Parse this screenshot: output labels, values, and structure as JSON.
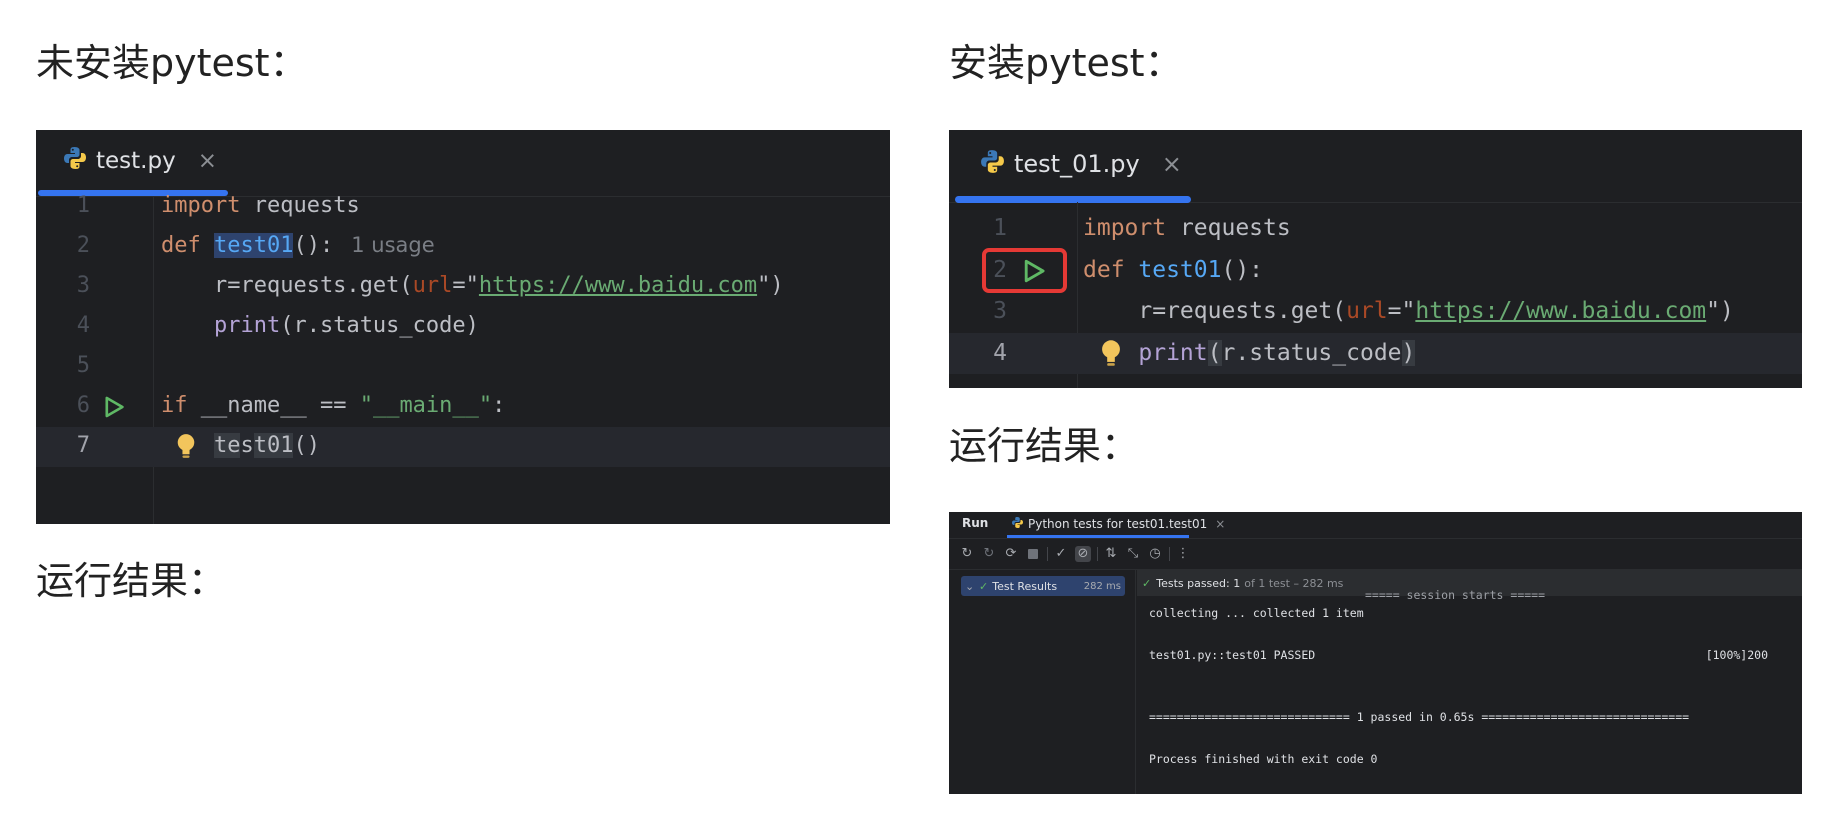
{
  "headings": {
    "left_top": "未安装pytest：",
    "left_result": "运行结果：",
    "right_top": "安装pytest：",
    "right_result": "运行结果："
  },
  "editor_left": {
    "tab_label": "test.py",
    "tab_close": "×",
    "current_line": 7,
    "lines": [
      {
        "num": "1",
        "parts": [
          [
            "kw",
            "import"
          ],
          [
            "txt",
            " requests"
          ]
        ]
      },
      {
        "num": "2",
        "parts": [
          [
            "kw",
            "def "
          ],
          [
            "fnhl",
            "test01"
          ],
          [
            "txt",
            "():"
          ]
        ],
        "hint": "1 usage"
      },
      {
        "num": "3",
        "parts": [
          [
            "txt",
            "    r=requests.get("
          ],
          [
            "param",
            "url"
          ],
          [
            "txt",
            "=\""
          ],
          [
            "url",
            "https://www.baidu.com"
          ],
          [
            "txt",
            "\")"
          ]
        ]
      },
      {
        "num": "4",
        "parts": [
          [
            "txt",
            "    "
          ],
          [
            "call",
            "print"
          ],
          [
            "txt",
            "(r.status_code)"
          ]
        ]
      },
      {
        "num": "5",
        "parts": []
      },
      {
        "num": "6",
        "parts": [
          [
            "kw",
            "if "
          ],
          [
            "txt",
            "__name__ == "
          ],
          [
            "str",
            "\"__main__\""
          ],
          [
            "txt",
            ":"
          ]
        ],
        "run_icon": "run-triangle-icon"
      },
      {
        "num": "7",
        "parts": [
          [
            "txt",
            "    "
          ],
          [
            "hl",
            "te"
          ],
          [
            "txt",
            "s"
          ],
          [
            "hl",
            "t01"
          ],
          [
            "txt",
            "()"
          ]
        ],
        "bulb": "lightbulb-icon"
      }
    ]
  },
  "editor_right": {
    "tab_label": "test_01.py",
    "tab_close": "×",
    "current_line": 4,
    "lines": [
      {
        "num": "1",
        "parts": [
          [
            "kw",
            "import"
          ],
          [
            "txt",
            " requests"
          ]
        ]
      },
      {
        "num": "2",
        "parts": [
          [
            "kw",
            "def "
          ],
          [
            "fn",
            "test01"
          ],
          [
            "txt",
            "():"
          ]
        ],
        "run_icon": "run-triangle-icon",
        "boxed": true
      },
      {
        "num": "3",
        "parts": [
          [
            "txt",
            "    r=requests.get("
          ],
          [
            "param",
            "url"
          ],
          [
            "txt",
            "=\""
          ],
          [
            "url",
            "https://www.baidu.com"
          ],
          [
            "txt",
            "\")"
          ]
        ]
      },
      {
        "num": "4",
        "parts": [
          [
            "txt",
            "    "
          ],
          [
            "call",
            "print"
          ],
          [
            "hl",
            "("
          ],
          [
            "txt",
            "r.status_code"
          ],
          [
            "hl",
            ")"
          ]
        ],
        "bulb": "lightbulb-icon"
      }
    ]
  },
  "run_panel": {
    "run_label": "Run",
    "tab_label": "Python tests for test01.test01",
    "tab_close": "×",
    "tree": {
      "label": "Test Results",
      "duration": "282 ms"
    },
    "status": {
      "passed": "Tests passed: 1",
      "detail": "of 1 test – 282 ms"
    },
    "console": {
      "partial_top": "===== session starts =====",
      "collecting": "collecting ... collected 1 item",
      "test_line": "test01.py::test01 PASSED",
      "test_line_right": "[100%]200",
      "summary": "============================= 1 passed in 0.65s ==============================",
      "finished": "Process finished with exit code 0"
    }
  },
  "colors": {
    "editor_bg": "#1e1f22",
    "keyword": "#cf8e6d",
    "function": "#56a8f5",
    "string": "#6aab73",
    "accent": "#3574f0",
    "red_box": "#e53935",
    "pass_green": "#5fb865"
  }
}
